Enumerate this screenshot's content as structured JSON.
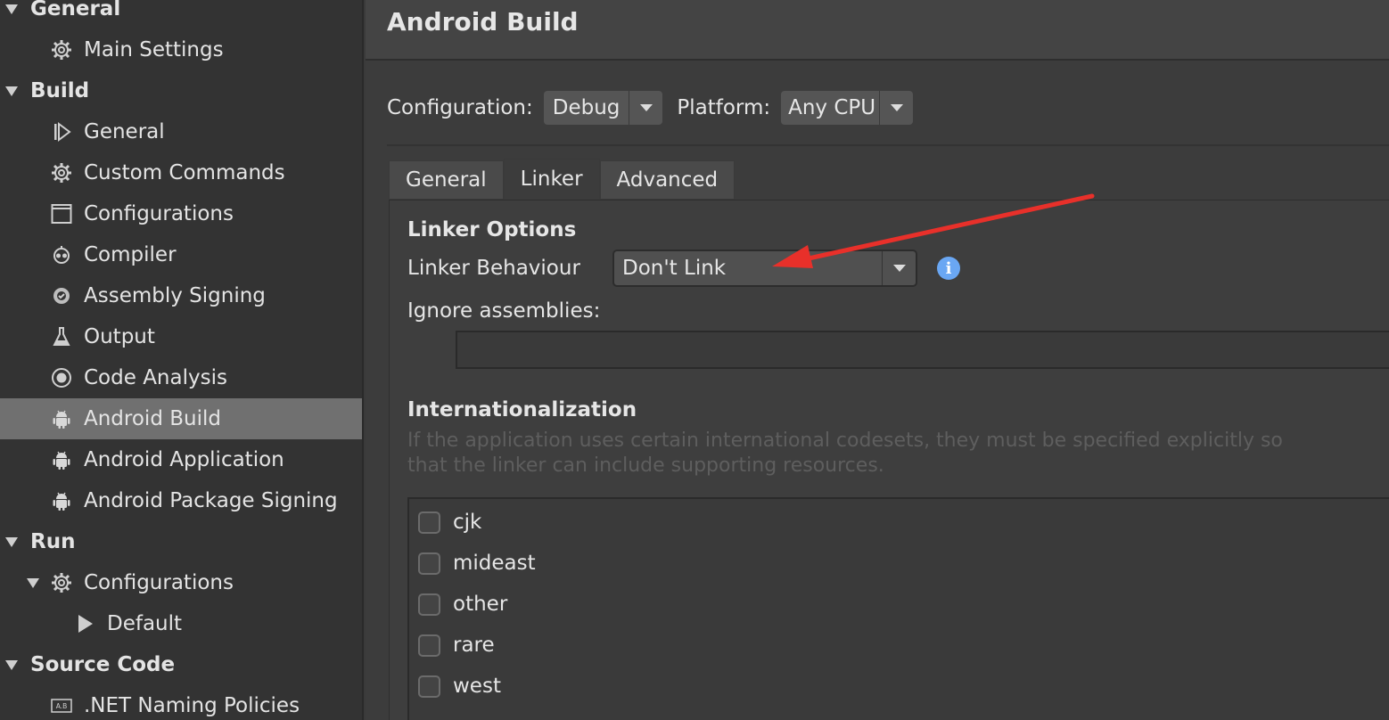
{
  "sidebar": {
    "items": [
      {
        "label": "General",
        "kind": "section",
        "icon": "triangle-down-icon"
      },
      {
        "label": "Main Settings",
        "kind": "item",
        "icon": "gear-icon"
      },
      {
        "label": "Build",
        "kind": "section",
        "icon": "triangle-down-icon"
      },
      {
        "label": "General",
        "kind": "item",
        "icon": "build-play-icon"
      },
      {
        "label": "Custom Commands",
        "kind": "item",
        "icon": "gear-icon"
      },
      {
        "label": "Configurations",
        "kind": "item",
        "icon": "window-icon"
      },
      {
        "label": "Compiler",
        "kind": "item",
        "icon": "compiler-icon"
      },
      {
        "label": "Assembly Signing",
        "kind": "item",
        "icon": "seal-icon"
      },
      {
        "label": "Output",
        "kind": "item",
        "icon": "flask-icon"
      },
      {
        "label": "Code Analysis",
        "kind": "item",
        "icon": "radio-icon"
      },
      {
        "label": "Android Build",
        "kind": "item",
        "icon": "android-icon",
        "selected": true
      },
      {
        "label": "Android Application",
        "kind": "item",
        "icon": "android-icon"
      },
      {
        "label": "Android Package Signing",
        "kind": "item",
        "icon": "android-icon"
      },
      {
        "label": "Run",
        "kind": "section",
        "icon": "triangle-down-icon"
      },
      {
        "label": "Configurations",
        "kind": "item-expand",
        "icon": "gear-icon"
      },
      {
        "label": "Default",
        "kind": "item-leaf",
        "icon": "play-icon"
      },
      {
        "label": "Source Code",
        "kind": "section",
        "icon": "triangle-down-icon"
      },
      {
        "label": ".NET Naming Policies",
        "kind": "item",
        "icon": "naming-icon"
      }
    ]
  },
  "header": {
    "title": "Android Build"
  },
  "config": {
    "configuration_label": "Configuration:",
    "configuration_value": "Debug",
    "platform_label": "Platform:",
    "platform_value": "Any CPU"
  },
  "tabs": [
    {
      "label": "General",
      "active": false
    },
    {
      "label": "Linker",
      "active": true
    },
    {
      "label": "Advanced",
      "active": false
    }
  ],
  "linker": {
    "section_title": "Linker Options",
    "behaviour_label": "Linker Behaviour",
    "behaviour_value": "Don't Link",
    "info_glyph": "i",
    "ignore_label": "Ignore assemblies:"
  },
  "i18n": {
    "section_title": "Internationalization",
    "hint": "If the application uses certain international codesets, they must be specified explicitly so that the linker can include supporting resources.",
    "codesets": [
      {
        "label": "cjk",
        "checked": false
      },
      {
        "label": "mideast",
        "checked": false
      },
      {
        "label": "other",
        "checked": false
      },
      {
        "label": "rare",
        "checked": false
      },
      {
        "label": "west",
        "checked": false
      }
    ]
  },
  "colors": {
    "annotation_arrow": "#e8302a",
    "selection": "#707070",
    "info_blue": "#6aa7f3"
  }
}
